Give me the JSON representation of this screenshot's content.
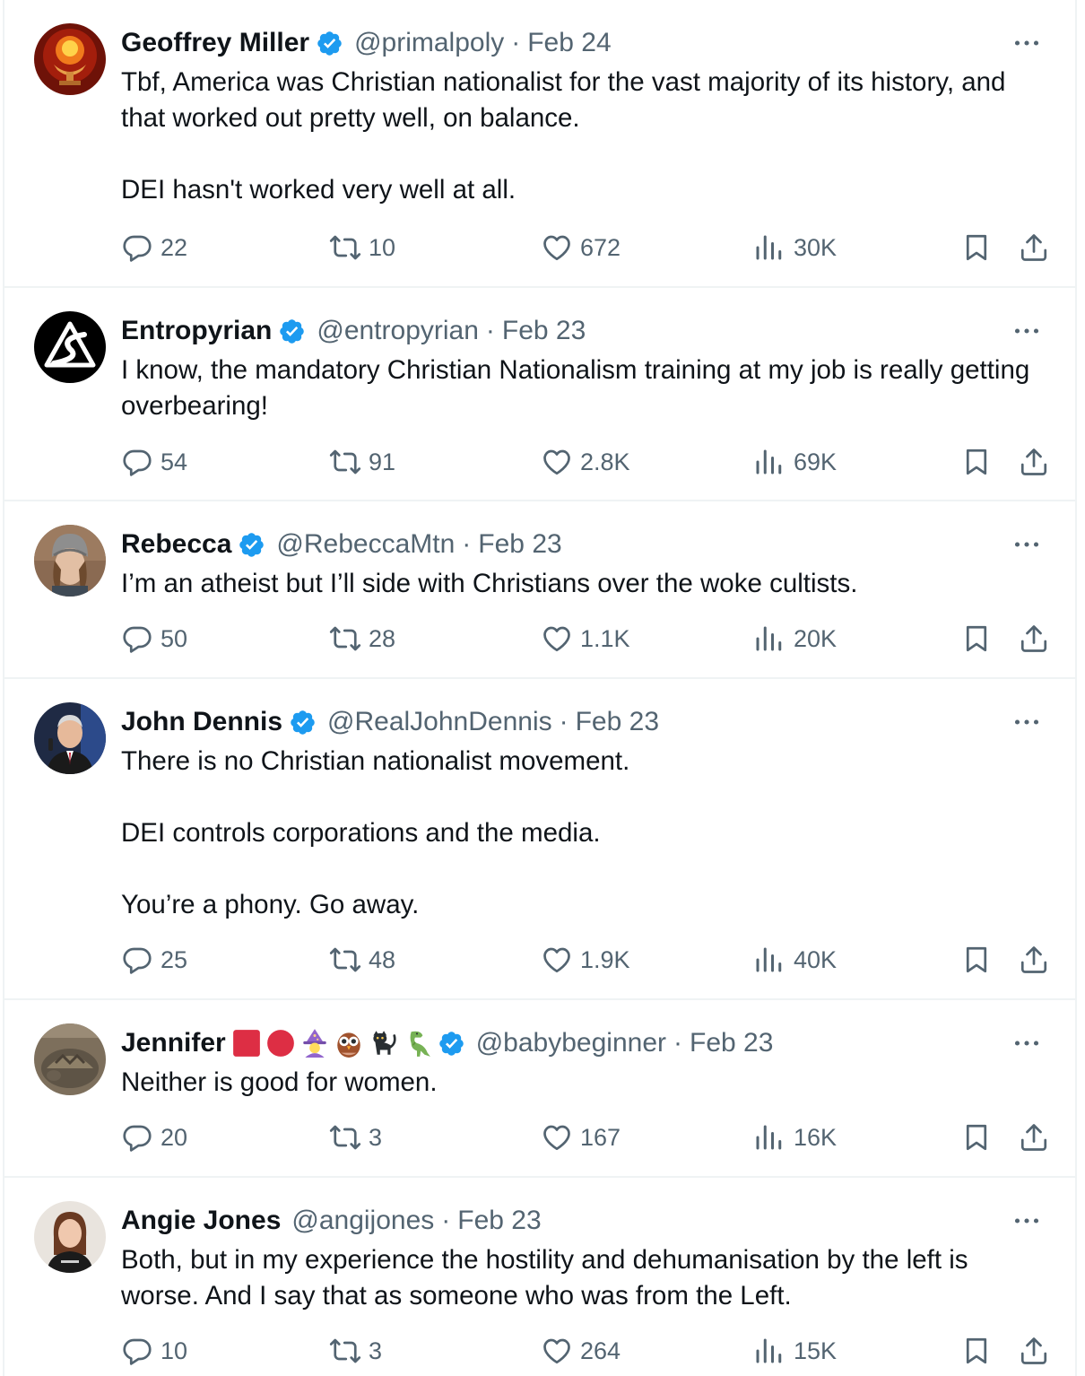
{
  "tweets": [
    {
      "name": "Geoffrey Miller",
      "verified": true,
      "handle": "@primalpoly",
      "separator": "·",
      "date": "Feb 24",
      "text": "Tbf, America was Christian nationalist for the vast majority of its history, and that worked out pretty well, on balance.\n\nDEI hasn't worked very well at all.",
      "replies": "22",
      "reposts": "10",
      "likes": "672",
      "views": "30K"
    },
    {
      "name": "Entropyrian",
      "verified": true,
      "handle": "@entropyrian",
      "separator": "·",
      "date": "Feb 23",
      "text": "I know, the mandatory Christian Nationalism training at my job is really getting overbearing!",
      "replies": "54",
      "reposts": "91",
      "likes": "2.8K",
      "views": "69K"
    },
    {
      "name": "Rebecca",
      "verified": true,
      "handle": "@RebeccaMtn",
      "separator": "·",
      "date": "Feb 23",
      "text": "I’m an atheist but I’ll side with Christians over the woke cultists.",
      "replies": "50",
      "reposts": "28",
      "likes": "1.1K",
      "views": "20K"
    },
    {
      "name": "John Dennis",
      "verified": true,
      "handle": "@RealJohnDennis",
      "separator": "·",
      "date": "Feb 23",
      "text": "There is no Christian nationalist movement.\n\nDEI controls corporations and the media.\n\nYou’re a phony. Go away.",
      "replies": "25",
      "reposts": "48",
      "likes": "1.9K",
      "views": "40K"
    },
    {
      "name": "Jennifer",
      "name_emojis": [
        "red-square",
        "red-circle",
        "wizard-woman",
        "owl",
        "black-cat",
        "t-rex"
      ],
      "verified": true,
      "handle": "@babybeginner",
      "separator": "·",
      "date": "Feb 23",
      "text": "Neither is good for women.",
      "replies": "20",
      "reposts": "3",
      "likes": "167",
      "views": "16K"
    },
    {
      "name": "Angie Jones",
      "verified": false,
      "handle": "@angijones",
      "separator": "·",
      "date": "Feb 23",
      "text": "Both, but in my experience the hostility and dehumanisation by the left is worse. And I say that as someone who was from the Left.",
      "replies": "10",
      "reposts": "3",
      "likes": "264",
      "views": "15K"
    }
  ],
  "colors": {
    "text": "#0f1419",
    "secondary": "#536471",
    "verified": "#1d9bf0",
    "divider": "#eff3f4"
  },
  "icons": [
    "reply-icon",
    "repost-icon",
    "like-icon",
    "views-icon",
    "bookmark-icon",
    "share-icon",
    "more-icon",
    "verified-badge-icon"
  ]
}
